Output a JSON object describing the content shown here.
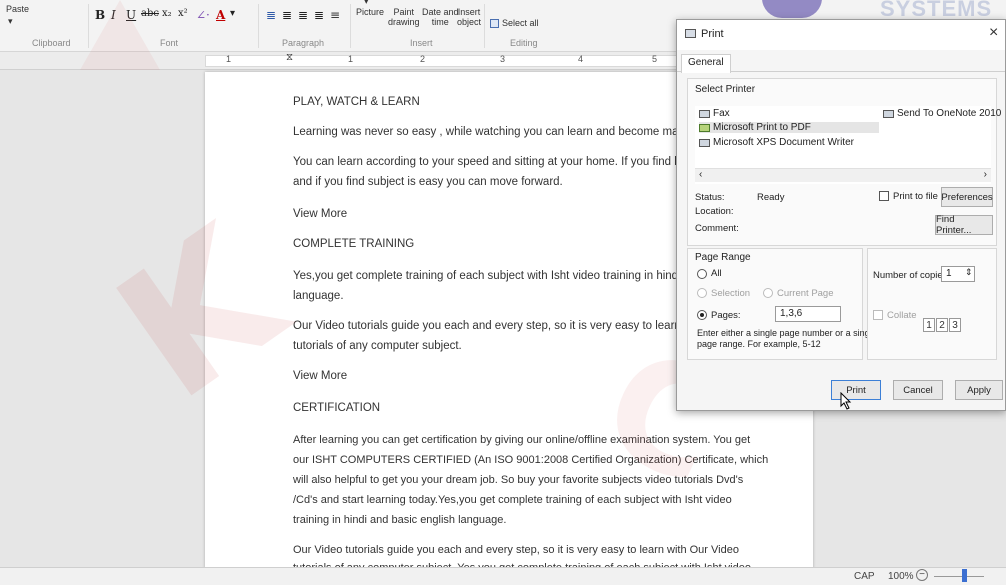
{
  "ribbon": {
    "paste_label": "Paste",
    "clipboard_label": "Clipboard",
    "font_label": "Font",
    "paragraph_label": "Paragraph",
    "insert_label": "Insert",
    "editing_label": "Editing",
    "picture_label": "Picture",
    "paint_drawing_label1": "Paint",
    "paint_drawing_label2": "drawing",
    "datetime_label1": "Date and",
    "datetime_label2": "time",
    "insert_object_label1": "Insert",
    "insert_object_label2": "object",
    "select_all_label": "Select all"
  },
  "ruler": {
    "numbers": [
      "1",
      "1",
      "2",
      "3",
      "4",
      "5"
    ]
  },
  "document": {
    "paragraphs": [
      "PLAY, WATCH & LEARN",
      "Learning was never so easy , while watching you can learn and become master in ar",
      "You can learn according to your speed and sitting at your home. If you find hard you",
      "and if you find subject is easy you can move forward.",
      "View More",
      "COMPLETE TRAINING",
      "Yes,you get complete training of each subject with Isht video training in hindi and ba",
      "language.",
      "Our Video tutorials guide you each and every step, so it is very easy to learn with O",
      "tutorials of any computer subject.",
      "View More",
      "CERTIFICATION",
      "After learning you can get certification by giving our online/offline examination system. You get",
      "our ISHT COMPUTERS CERTIFIED (An ISO 9001:2008  Certified Organization) Certificate, which",
      "will also helpful to get you your dream job. So buy your favorite subjects video tutorials Dvd's",
      "/Cd's and start learning today.Yes,you get complete training of each subject with Isht video",
      "training in hindi and basic english language.",
      "Our Video tutorials guide you each and every step, so it is very easy to learn with Our Video",
      "tutorials of any computer subject. Yes you get complete training of each subject with Isht video"
    ]
  },
  "watermark": {
    "brand_text": "SYSTEMS"
  },
  "statusbar": {
    "caps": "CAP",
    "zoom": "100%"
  },
  "dialog": {
    "title": "Print",
    "close_glyph": "×",
    "tab_general": "General",
    "select_printer_label": "Select Printer",
    "printers": [
      "Fax",
      "Microsoft Print to PDF",
      "Microsoft XPS Document Writer",
      "Send To OneNote 2010"
    ],
    "status_label": "Status:",
    "status_value": "Ready",
    "location_label": "Location:",
    "comment_label": "Comment:",
    "print_to_file_label": "Print to file",
    "preferences_label": "Preferences",
    "find_printer_label": "Find Printer...",
    "page_range_label": "Page Range",
    "all_label": "All",
    "selection_label": "Selection",
    "current_page_label": "Current Page",
    "pages_label": "Pages:",
    "pages_value": "1,3,6",
    "hint_line1": "Enter either a single page number or a single",
    "hint_line2": "page range.  For example, 5-12",
    "copies_label": "Number of copies:",
    "copies_value": "1",
    "collate_label": "Collate",
    "print_button": "Print",
    "cancel_button": "Cancel",
    "apply_button": "Apply"
  }
}
